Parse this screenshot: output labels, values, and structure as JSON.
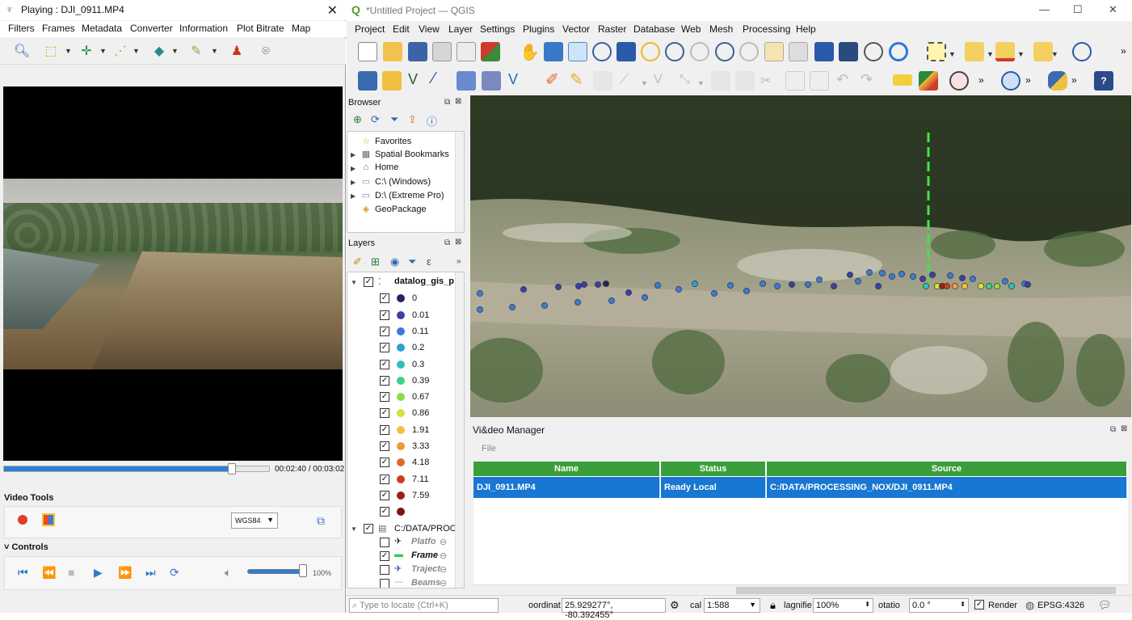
{
  "player": {
    "title": "Playing : DJI_0911.MP4",
    "menu": [
      "Filters",
      "Frames",
      "Metadata",
      "Converter",
      "Information",
      "Plot Bitrate",
      "Map"
    ],
    "progress": 0.86,
    "time": "00:02:40 / 00:03:02",
    "video_tools_label": "Video Tools",
    "crs": "WGS84",
    "controls_label": "Controls",
    "volume": 1.0,
    "volume_label": "100%"
  },
  "qgis": {
    "title": "*Untitled Project — QGIS",
    "menu": [
      "Project",
      "Edit",
      "View",
      "Layer",
      "Settings",
      "Plugins",
      "Vector",
      "Raster",
      "Database",
      "Web",
      "Mesh",
      "Processing",
      "Help"
    ],
    "browser": {
      "title": "Browser",
      "items": [
        {
          "label": "Favorites",
          "icon": "star-icon",
          "expand": false
        },
        {
          "label": "Spatial Bookmarks",
          "icon": "bookmark-icon",
          "expand": true
        },
        {
          "label": "Home",
          "icon": "home-icon",
          "expand": true
        },
        {
          "label": "C:\\ (Windows)",
          "icon": "drive-icon",
          "expand": true
        },
        {
          "label": "D:\\ (Extreme Pro)",
          "icon": "drive-icon",
          "expand": true
        },
        {
          "label": "GeoPackage",
          "icon": "geopackage-icon",
          "expand": false
        }
      ]
    },
    "layers": {
      "title": "Layers",
      "group1": "datalog_gis_p",
      "classes": [
        {
          "label": "0",
          "color": "#2d1f63"
        },
        {
          "label": "0.01",
          "color": "#3c3fa8"
        },
        {
          "label": "0.11",
          "color": "#3b7ad8"
        },
        {
          "label": "0.2",
          "color": "#2f9fd8"
        },
        {
          "label": "0.3",
          "color": "#2fc0b8"
        },
        {
          "label": "0.39",
          "color": "#3cd08a"
        },
        {
          "label": "0.67",
          "color": "#8ddc4a"
        },
        {
          "label": "0.86",
          "color": "#d8e040"
        },
        {
          "label": "1.91",
          "color": "#f0c040"
        },
        {
          "label": "3.33",
          "color": "#f09a3a"
        },
        {
          "label": "4.18",
          "color": "#e06a2a"
        },
        {
          "label": "7.11",
          "color": "#c8401e"
        },
        {
          "label": "7.59",
          "color": "#9a2214"
        },
        {
          "label": "",
          "color": "#7a1410"
        }
      ],
      "group2": "C:/DATA/PROC",
      "sublayers": [
        {
          "label": "Platfo",
          "checked": false
        },
        {
          "label": "Frame",
          "checked": true
        },
        {
          "label": "Traject",
          "checked": false
        },
        {
          "label": "Beams",
          "checked": false
        }
      ]
    },
    "video_manager": {
      "title": "Vi&deo Manager",
      "file_menu": "File",
      "columns": [
        "Name",
        "Status",
        "Source"
      ],
      "rows": [
        {
          "name": "DJI_0911.MP4",
          "status": "Ready Local",
          "source": "C:/DATA/PROCESSING_NOX/DJI_0911.MP4"
        }
      ]
    },
    "statusbar": {
      "locate_placeholder": "Type to locate (Ctrl+K)",
      "coord_label": "oordinat",
      "coordinate": "25.929277°, -80.392455°",
      "scale_label": "cal",
      "scale": "1:588",
      "magnifier_label": "lagnifie",
      "magnifier": "100%",
      "rotation_label": "otatio",
      "rotation": "0.0 °",
      "render_label": "Render",
      "crs": "EPSG:4326"
    }
  }
}
